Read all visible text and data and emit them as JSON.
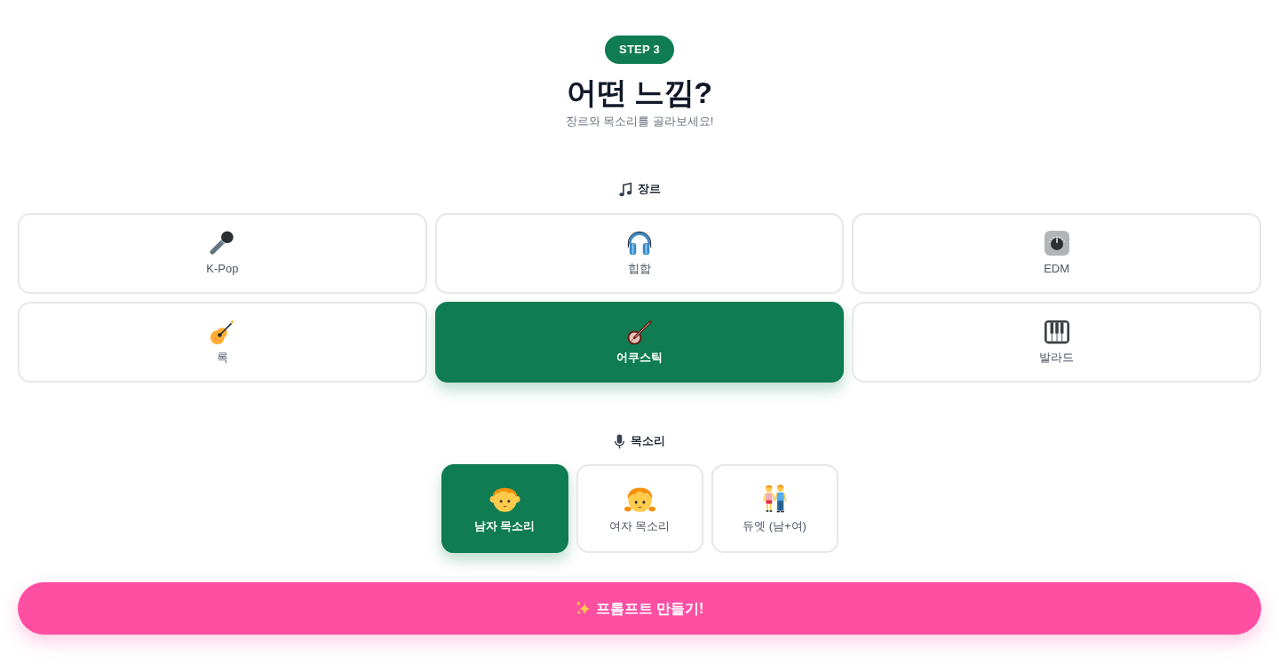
{
  "badge": "STEP 3",
  "title": "어떤 느낌?",
  "subtitle": "장르와 목소리를 골라보세요!",
  "genre_section": {
    "label": "장르",
    "options": [
      {
        "label": "K-Pop",
        "selected": false
      },
      {
        "label": "힙합",
        "selected": false
      },
      {
        "label": "EDM",
        "selected": false
      },
      {
        "label": "록",
        "selected": false
      },
      {
        "label": "어쿠스틱",
        "selected": true
      },
      {
        "label": "발라드",
        "selected": false
      }
    ]
  },
  "voice_section": {
    "label": "목소리",
    "options": [
      {
        "label": "남자 목소리",
        "selected": true
      },
      {
        "label": "여자 목소리",
        "selected": false
      },
      {
        "label": "듀엣 (남+여)",
        "selected": false
      }
    ]
  },
  "submit_button": {
    "label": "프롬프트 만들기!"
  }
}
